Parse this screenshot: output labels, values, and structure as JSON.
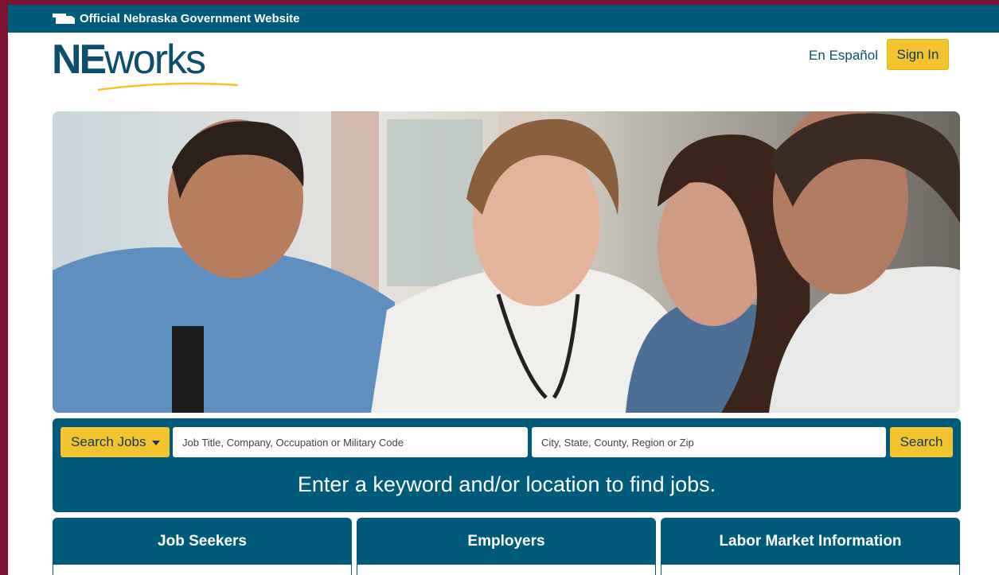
{
  "gov_bar": {
    "text": "Official Nebraska Government Website"
  },
  "header": {
    "logo_ne": "NE",
    "logo_works": "works",
    "language_link": "En Español",
    "sign_in_label": "Sign In"
  },
  "search": {
    "mode_label": "Search Jobs",
    "keyword_placeholder": "Job Title, Company, Occupation or Military Code",
    "location_placeholder": "City, State, County, Region or Zip",
    "search_label": "Search",
    "hint": "Enter a keyword and/or location to find jobs."
  },
  "cards": [
    {
      "title": "Job Seekers"
    },
    {
      "title": "Employers"
    },
    {
      "title": "Labor Market Information"
    }
  ],
  "colors": {
    "brand_blue": "#005a7a",
    "accent_yellow": "#f4c430",
    "frame_maroon": "#7a1432"
  },
  "icons": {
    "gov_bar": "nebraska-state-icon",
    "search_mode": "caret-down-icon"
  }
}
